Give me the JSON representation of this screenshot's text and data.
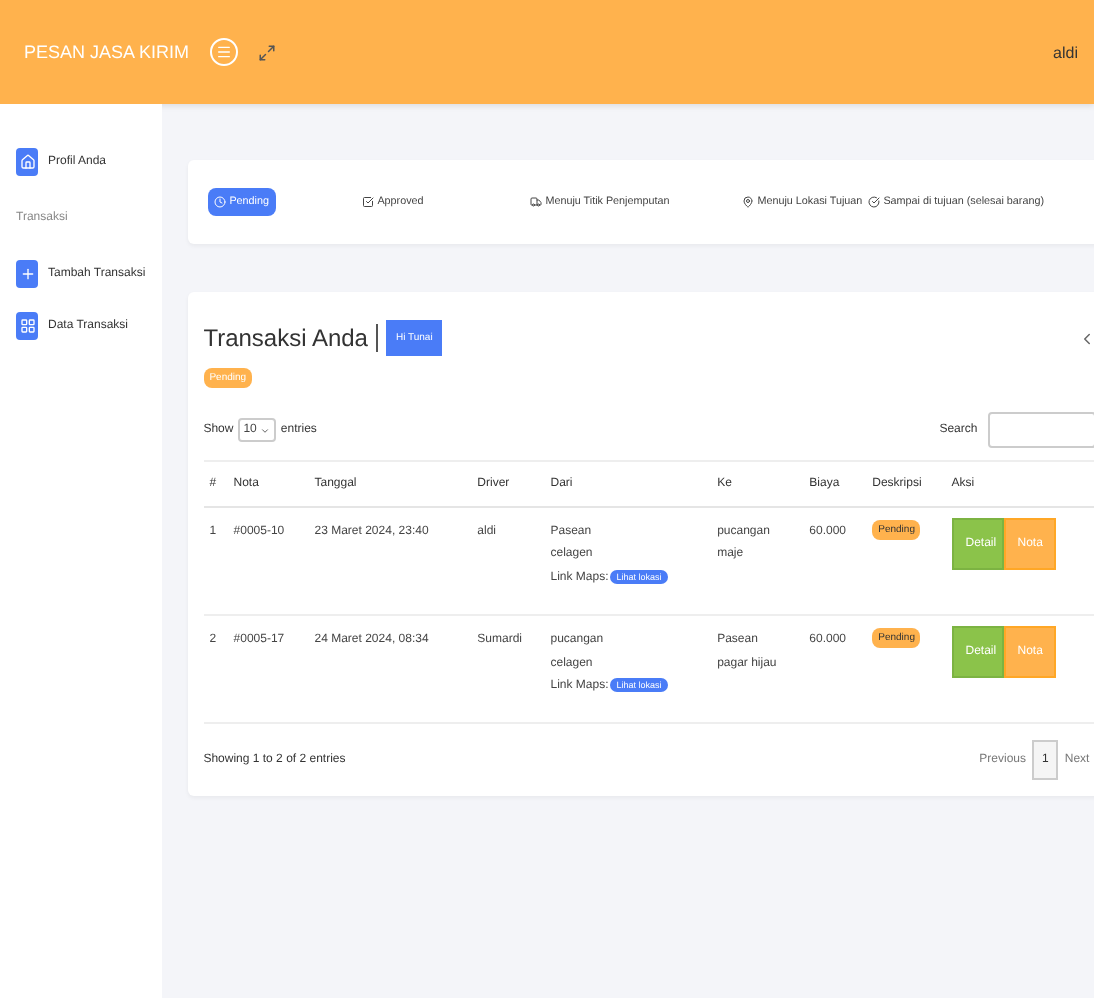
{
  "header": {
    "brand": "PESAN JASA KIRIM",
    "user": "aldi"
  },
  "sidebar": {
    "items": [
      {
        "kind": "link",
        "label": "Profil Anda"
      },
      {
        "kind": "section",
        "label": "Transaksi"
      },
      {
        "kind": "link",
        "label": "Tambah Transaksi"
      },
      {
        "kind": "link",
        "label": "Data Transaksi"
      }
    ]
  },
  "status_tabs": [
    {
      "label": "Pending",
      "selected": true
    },
    {
      "label": "Approved",
      "selected": false
    },
    {
      "label": "Menuju Titik Penjemputan",
      "selected": false
    },
    {
      "label": "Menuju Lokasi Tujuan",
      "selected": false
    },
    {
      "label": "Sampai di tujuan (selesai barang)",
      "selected": false
    }
  ],
  "panel": {
    "title": "Transaksi Anda",
    "button": "Hi Tunai",
    "status_badge": "Pending",
    "length_label_before": "Show",
    "length_value": "10",
    "length_label_after": "entries",
    "search_label": "Search",
    "columns": [
      "#",
      "Nota",
      "Tanggal",
      "Driver",
      "Dari",
      "Ke",
      "Biaya",
      "Deskripsi",
      "Aksi"
    ],
    "rows": [
      {
        "no": "1",
        "nota": "#0005-10",
        "tanggal": "23 Maret 2024, 23:40",
        "driver": "aldi",
        "dari": [
          "Pasean",
          "celagen"
        ],
        "maps_label": "Link Maps:",
        "maps_button": "Lihat lokasi",
        "ke": [
          "pucangan",
          "maje"
        ],
        "biaya": "60.000",
        "status": "Pending",
        "actions": [
          "Detail",
          "Nota"
        ]
      },
      {
        "no": "2",
        "nota": "#0005-17",
        "tanggal": "24 Maret 2024, 08:34",
        "driver": "Sumardi",
        "dari": [
          "pucangan",
          "celagen"
        ],
        "maps_label": "Link Maps:",
        "maps_button": "Lihat lokasi",
        "ke": [
          "Pasean",
          "pagar hijau"
        ],
        "biaya": "60.000",
        "status": "Pending",
        "actions": [
          "Detail",
          "Nota"
        ]
      }
    ],
    "info": "Showing 1 to 2 of 2 entries",
    "pagination": [
      {
        "label": "Previous",
        "selected": false
      },
      {
        "label": "1",
        "selected": true
      },
      {
        "label": "Next",
        "selected": false
      }
    ]
  }
}
